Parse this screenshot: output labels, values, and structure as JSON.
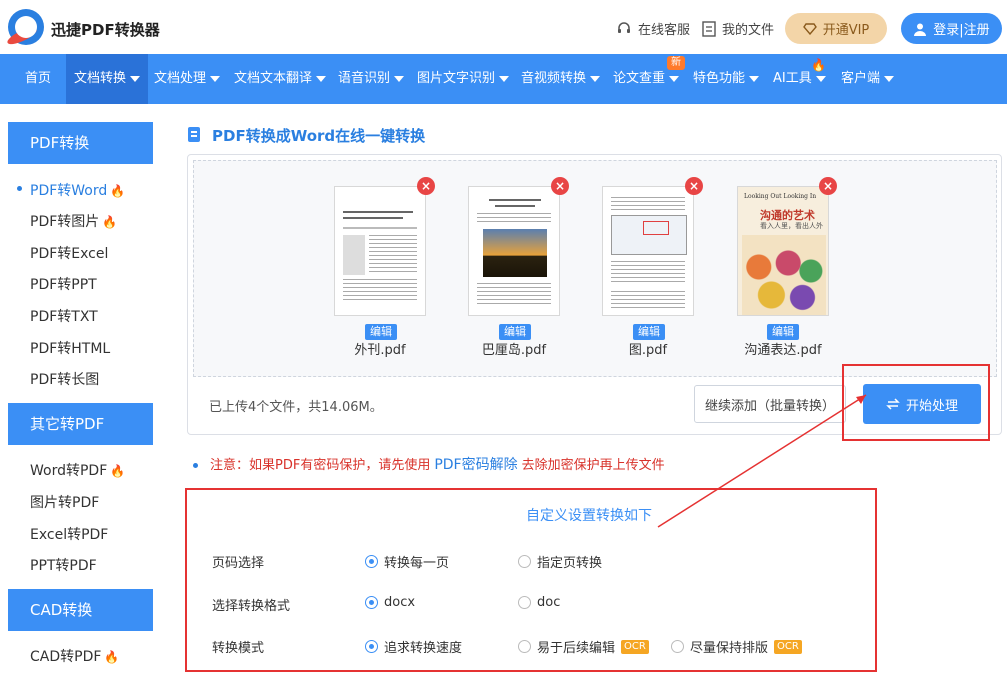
{
  "header": {
    "brand": "迅捷PDF转换器",
    "support": "在线客服",
    "my_files": "我的文件",
    "vip": "开通VIP",
    "login": "登录|注册"
  },
  "nav": {
    "items": [
      {
        "label": "首页",
        "caret": false
      },
      {
        "label": "文档转换",
        "caret": true
      },
      {
        "label": "文档处理",
        "caret": true
      },
      {
        "label": "文档文本翻译",
        "caret": true
      },
      {
        "label": "语音识别",
        "caret": true
      },
      {
        "label": "图片文字识别",
        "caret": true
      },
      {
        "label": "音视频转换",
        "caret": true
      },
      {
        "label": "论文查重",
        "caret": true
      },
      {
        "label": "特色功能",
        "caret": true
      },
      {
        "label": "AI工具",
        "caret": true
      },
      {
        "label": "客户端",
        "caret": true
      }
    ],
    "new_badge": "新"
  },
  "sidebar": {
    "sections": [
      {
        "title": "PDF转换",
        "items": [
          "PDF转Word",
          "PDF转图片",
          "PDF转Excel",
          "PDF转PPT",
          "PDF转TXT",
          "PDF转HTML",
          "PDF转长图"
        ]
      },
      {
        "title": "其它转PDF",
        "items": [
          "Word转PDF",
          "图片转PDF",
          "Excel转PDF",
          "PPT转PDF"
        ]
      },
      {
        "title": "CAD转换",
        "items": [
          "CAD转PDF"
        ]
      }
    ]
  },
  "main": {
    "title": "PDF转换成Word在线一键转换",
    "files": [
      {
        "name": "外刊.pdf",
        "edit": "编辑"
      },
      {
        "name": "巴厘岛.pdf",
        "edit": "编辑"
      },
      {
        "name": "图.pdf",
        "edit": "编辑"
      },
      {
        "name": "沟通表达.pdf",
        "edit": "编辑"
      }
    ],
    "upload_info": "已上传4个文件，共14.06M。",
    "add_button": "继续添加（批量转换）",
    "start_button": "开始处理",
    "note_prefix": "注意：如果PDF有密码保护，请先使用",
    "note_link": "PDF密码解除",
    "note_suffix": "去除加密保护再上传文件",
    "book_title": "沟通的艺术",
    "book_subtitle": "看入人里，看出人外",
    "book_en": "Looking Out Looking In"
  },
  "settings": {
    "title": "自定义设置转换如下",
    "rows": [
      {
        "label": "页码选择",
        "options": [
          {
            "text": "转换每一页",
            "checked": true,
            "ocr": false
          },
          {
            "text": "指定页转换",
            "checked": false,
            "ocr": false
          }
        ]
      },
      {
        "label": "选择转换格式",
        "options": [
          {
            "text": "docx",
            "checked": true,
            "ocr": false
          },
          {
            "text": "doc",
            "checked": false,
            "ocr": false
          }
        ]
      },
      {
        "label": "转换模式",
        "options": [
          {
            "text": "追求转换速度",
            "checked": true,
            "ocr": false
          },
          {
            "text": "易于后续编辑",
            "checked": false,
            "ocr": true
          },
          {
            "text": "尽量保持排版",
            "checked": false,
            "ocr": true
          }
        ]
      }
    ],
    "ocr_label": "OCR"
  },
  "colors": {
    "primary": "#3b8ff5",
    "highlight": "#e53232",
    "warning": "#d8322a"
  }
}
